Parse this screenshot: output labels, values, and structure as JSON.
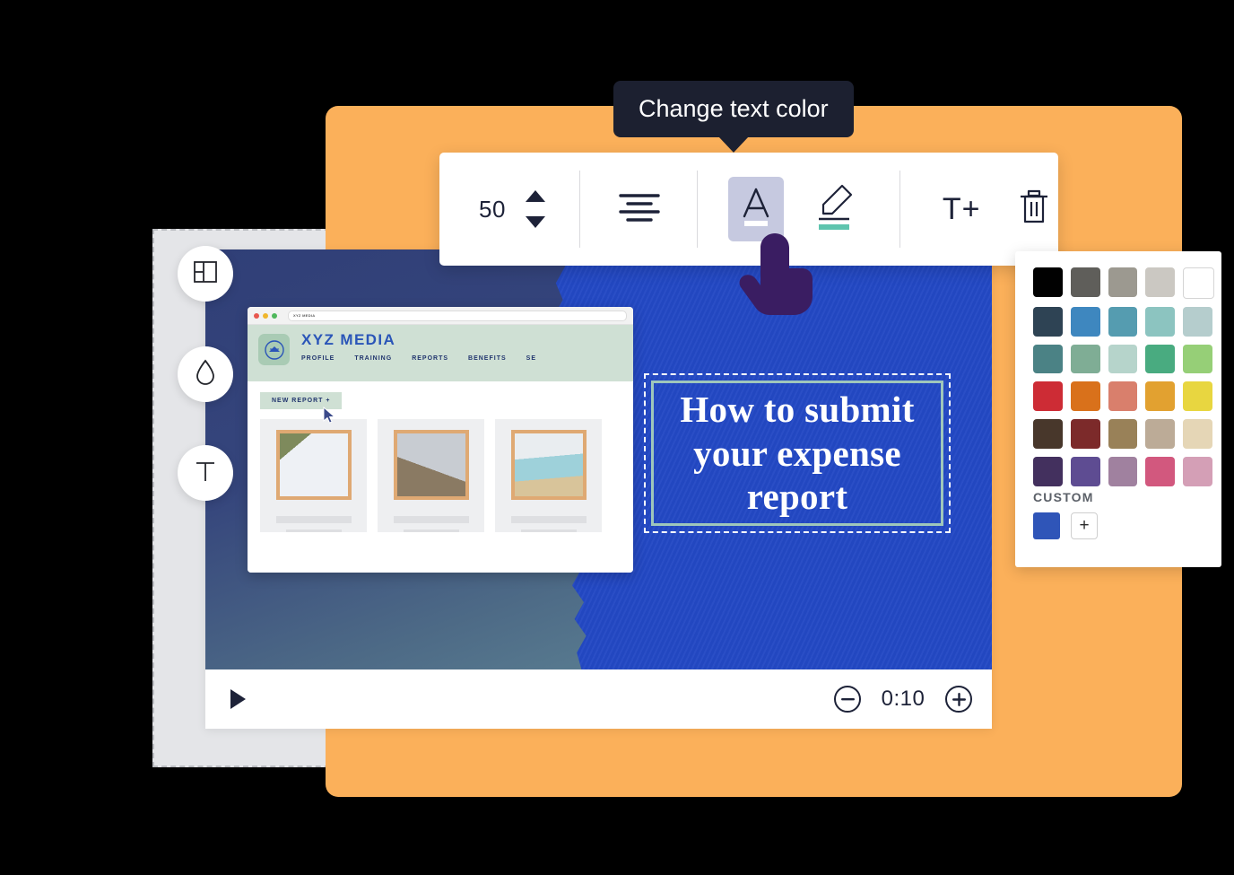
{
  "tooltip": {
    "text": "Change text color"
  },
  "toolbar": {
    "font_size_value": "50",
    "spinner_up_icon": "triangle-up-icon",
    "spinner_down_icon": "triangle-down-icon",
    "align_icon": "align-center-icon",
    "text_color_icon": "text-color-A-icon",
    "text_color_underline": "#ffffff",
    "highlight_icon": "highlighter-pen-icon",
    "highlight_color": "#5ec4ae",
    "add_text_label": "T+",
    "delete_icon": "trash-icon"
  },
  "left_tools": [
    {
      "name": "layout-icon",
      "label": "Layout"
    },
    {
      "name": "droplet-icon",
      "label": "Color fill"
    },
    {
      "name": "text-icon",
      "label": "T"
    }
  ],
  "video": {
    "title_lines": [
      "How to submit",
      "your expense",
      "report"
    ],
    "title_color": "#ffffff",
    "selection_border": "#9fc7bb",
    "background_color": "#2348c4",
    "playbar": {
      "play_icon": "play-icon",
      "zoom_out_icon": "minus-circle-icon",
      "time": "0:10",
      "zoom_in_icon": "plus-circle-icon"
    }
  },
  "browser_mock": {
    "url_text": "XYZ MEDIA",
    "brand": "XYZ MEDIA",
    "nav_items": [
      "PROFILE",
      "TRAINING",
      "REPORTS",
      "BENEFITS",
      "SE"
    ],
    "new_report_label": "NEW REPORT +",
    "header_bg": "#cfe0d4",
    "brand_color": "#2a55b8"
  },
  "palette": {
    "custom_label": "CUSTOM",
    "add_label": "+",
    "custom_swatch": "#2f55b8",
    "rows": [
      [
        "#010101",
        "#5f5e5a",
        "#9c9990",
        "#cbc8c2",
        "#ffffff"
      ],
      [
        "#2e4354",
        "#3e87bf",
        "#559cb0",
        "#8cc4c0",
        "#b5cdcd"
      ],
      [
        "#4b8285",
        "#7fad95",
        "#b6d4cb",
        "#49ab80",
        "#96cf77"
      ],
      [
        "#cd2c35",
        "#d9711b",
        "#d97f6c",
        "#e2a130",
        "#e8d640"
      ],
      [
        "#48372b",
        "#7c2a2a",
        "#998158",
        "#bcab97",
        "#e5d6b6"
      ],
      [
        "#43305e",
        "#5e4c92",
        "#a0819f",
        "#d2587e",
        "#d49fb6"
      ]
    ]
  },
  "canvas": {
    "orange_bg": "#fbb05a",
    "ghost_panel_bg": "#e4e5e8"
  }
}
